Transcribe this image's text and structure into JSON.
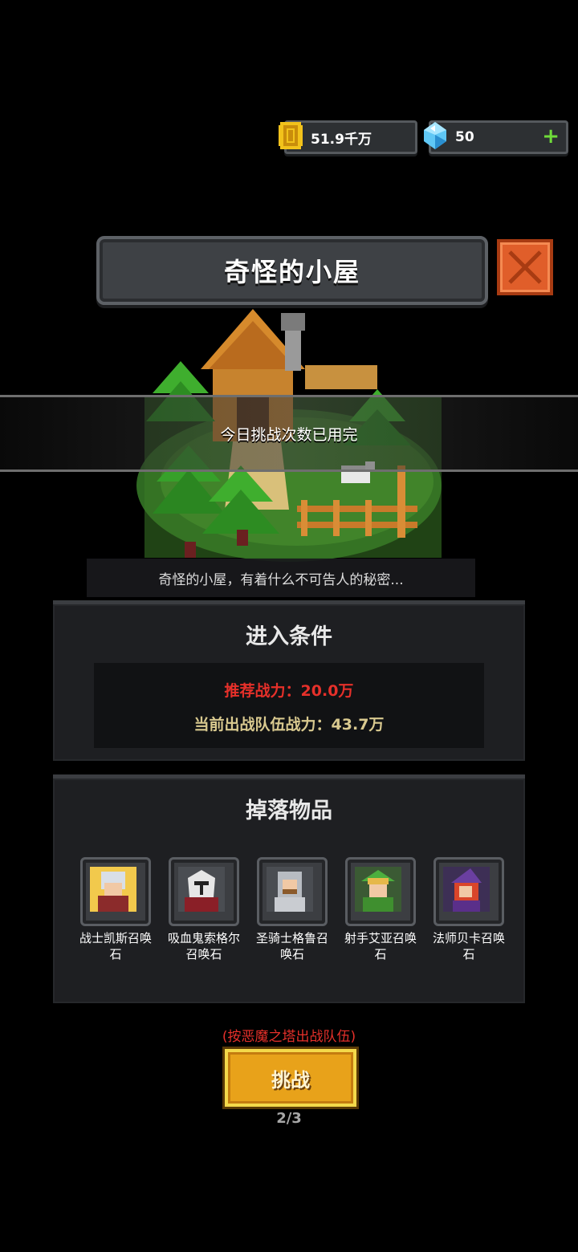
{
  "currency": {
    "gold": {
      "icon": "gold-coin-icon",
      "value": "51.9千万"
    },
    "gems": {
      "icon": "blue-gem-icon",
      "value": "50",
      "add_icon": "plus-icon"
    }
  },
  "header": {
    "title": "奇怪的小屋",
    "close_icon": "close-icon"
  },
  "banner": {
    "text": "今日挑战次数已用完"
  },
  "description": "奇怪的小屋，有着什么不可告人的秘密...",
  "conditions": {
    "title": "进入条件",
    "recommended": "推荐战力：20.0万",
    "current": "当前出战队伍战力：43.7万"
  },
  "drops": {
    "title": "掉落物品",
    "items": [
      {
        "label": "战士凯斯召唤石",
        "icon": "warrior-portrait-icon"
      },
      {
        "label": "吸血鬼索格尔召唤石",
        "icon": "vampire-portrait-icon"
      },
      {
        "label": "圣骑士格鲁召唤石",
        "icon": "paladin-portrait-icon"
      },
      {
        "label": "射手艾亚召唤石",
        "icon": "archer-portrait-icon"
      },
      {
        "label": "法师贝卡召唤石",
        "icon": "mage-portrait-icon"
      }
    ]
  },
  "hint": "(按恶魔之塔出战队伍)",
  "challenge_button": "挑战",
  "pager": "2/3",
  "colors": {
    "accent_red": "#e6302a",
    "gold": "#e8a21a",
    "close": "#e05e2a"
  }
}
